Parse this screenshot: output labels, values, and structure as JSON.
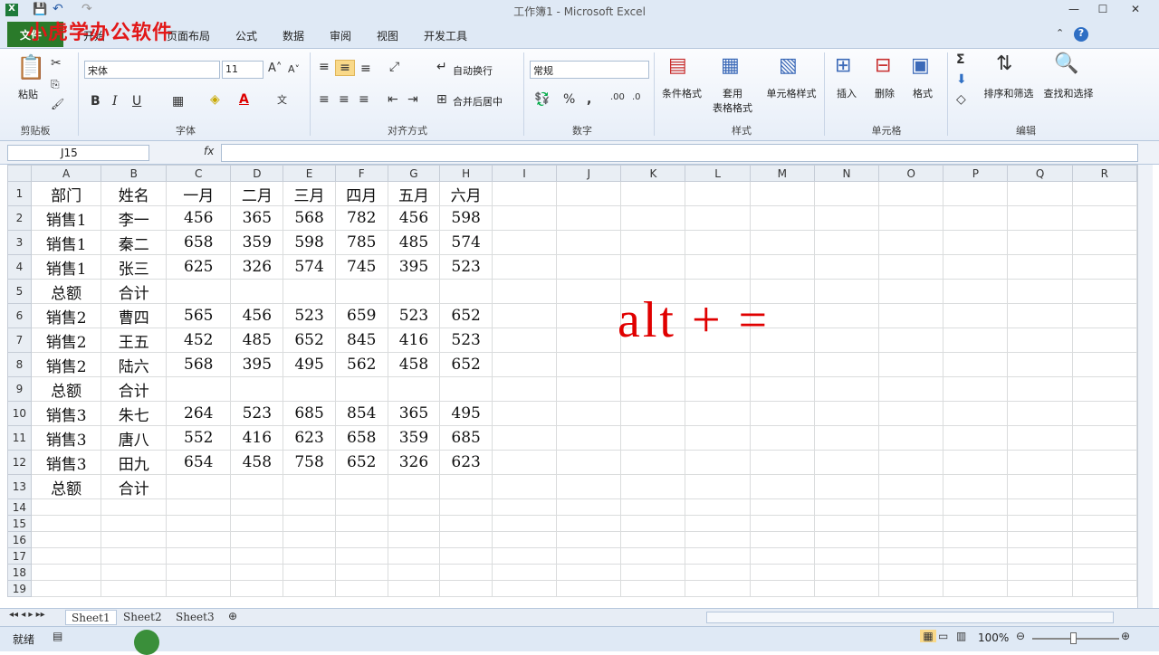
{
  "app": {
    "title": "工作簿1 - Microsoft Excel",
    "watermark": "小虎学办公软件"
  },
  "tabs": {
    "file": "文件",
    "home": "开始",
    "layout": "页面布局",
    "formula": "公式",
    "data": "数据",
    "review": "审阅",
    "view": "视图",
    "dev": "开发工具"
  },
  "ribbon": {
    "clipboard": {
      "paste": "粘贴",
      "group": "剪贴板"
    },
    "font": {
      "name": "宋体",
      "size": "11",
      "group": "字体"
    },
    "align": {
      "wrap": "自动换行",
      "merge": "合并后居中",
      "group": "对齐方式"
    },
    "number": {
      "format": "常规",
      "group": "数字"
    },
    "styles": {
      "cond": "条件格式",
      "table1": "套用",
      "table2": "表格格式",
      "cell": "单元格样式",
      "group": "样式"
    },
    "cells": {
      "insert": "插入",
      "delete": "删除",
      "format": "格式",
      "group": "单元格"
    },
    "edit": {
      "sort": "排序和筛选",
      "find": "查找和选择",
      "group": "编辑"
    }
  },
  "formula_bar": {
    "name_box": "J15",
    "fx": "fx",
    "value": ""
  },
  "columns": [
    "A",
    "B",
    "C",
    "D",
    "E",
    "F",
    "G",
    "H",
    "I",
    "J",
    "K",
    "L",
    "M",
    "N",
    "O",
    "P",
    "Q",
    "R"
  ],
  "rows": [
    [
      "部门",
      "姓名",
      "一月",
      "二月",
      "三月",
      "四月",
      "五月",
      "六月"
    ],
    [
      "销售1",
      "李一",
      "456",
      "365",
      "568",
      "782",
      "456",
      "598"
    ],
    [
      "销售1",
      "秦二",
      "658",
      "359",
      "598",
      "785",
      "485",
      "574"
    ],
    [
      "销售1",
      "张三",
      "625",
      "326",
      "574",
      "745",
      "395",
      "523"
    ],
    [
      "总额",
      "合计",
      "",
      "",
      "",
      "",
      "",
      ""
    ],
    [
      "销售2",
      "曹四",
      "565",
      "456",
      "523",
      "659",
      "523",
      "652"
    ],
    [
      "销售2",
      "王五",
      "452",
      "485",
      "652",
      "845",
      "416",
      "523"
    ],
    [
      "销售2",
      "陆六",
      "568",
      "395",
      "495",
      "562",
      "458",
      "652"
    ],
    [
      "总额",
      "合计",
      "",
      "",
      "",
      "",
      "",
      ""
    ],
    [
      "销售3",
      "朱七",
      "264",
      "523",
      "685",
      "854",
      "365",
      "495"
    ],
    [
      "销售3",
      "唐八",
      "552",
      "416",
      "623",
      "658",
      "359",
      "685"
    ],
    [
      "销售3",
      "田九",
      "654",
      "458",
      "758",
      "652",
      "326",
      "623"
    ],
    [
      "总额",
      "合计",
      "",
      "",
      "",
      "",
      "",
      ""
    ],
    [
      "",
      "",
      "",
      "",
      "",
      "",
      "",
      ""
    ],
    [
      "",
      "",
      "",
      "",
      "",
      "",
      "",
      ""
    ],
    [
      "",
      "",
      "",
      "",
      "",
      "",
      "",
      ""
    ],
    [
      "",
      "",
      "",
      "",
      "",
      "",
      "",
      ""
    ],
    [
      "",
      "",
      "",
      "",
      "",
      "",
      "",
      ""
    ],
    [
      "",
      "",
      "",
      "",
      "",
      "",
      "",
      ""
    ]
  ],
  "overlay_text": "alt + =",
  "sheets": [
    "Sheet1",
    "Sheet2",
    "Sheet3"
  ],
  "status": {
    "ready": "就绪",
    "zoom": "100%"
  }
}
